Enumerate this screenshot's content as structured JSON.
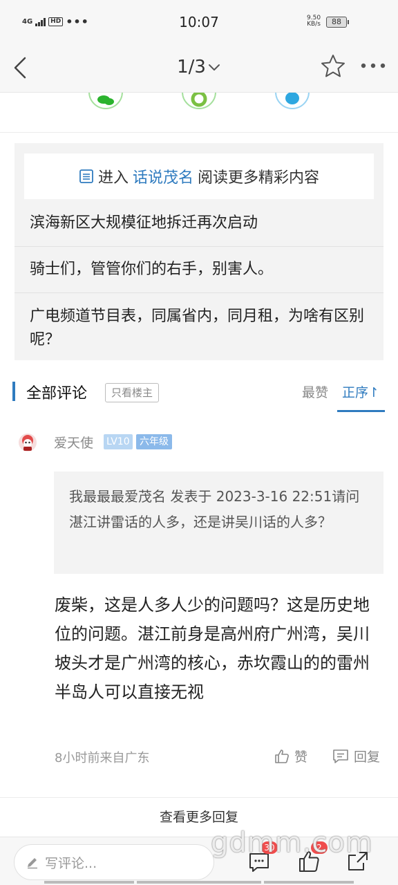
{
  "status_bar": {
    "network": "4G",
    "hd": "HD",
    "dots": "•••",
    "time": "10:07",
    "speed_value": "9.50",
    "speed_unit": "KB/s",
    "battery": "88"
  },
  "nav": {
    "title": "1/3",
    "back_icon": "chevron-left-icon",
    "favorite_icon": "star-outline-icon",
    "more_icon": "more-horizontal-icon"
  },
  "share": {
    "icons": [
      "wechat-icon",
      "moments-icon",
      "qq-icon"
    ],
    "colors": {
      "wechat": "#2bb32e",
      "moments": "#7bc043",
      "qq": "#2ea7e0"
    }
  },
  "related": {
    "enter_prefix": "进入",
    "forum_name": "话说茂名",
    "enter_suffix": "阅读更多精彩内容",
    "items": [
      "滨海新区大规模征地拆迁再次启动",
      "骑士们，管管你们的右手，别害人。",
      "广电频道节目表，同属省内，同月租，为啥有区别呢？"
    ]
  },
  "comments_header": {
    "title": "全部评论",
    "owner_only": "只看楼主",
    "sort_hot": "最赞",
    "sort_asc": "正序↾",
    "accent_color": "#2f7bbf"
  },
  "comment": {
    "username": "爱天使",
    "level": "LV10",
    "grade": "六年级",
    "quote": "我最最最爱茂名 发表于 2023-3-16 22:51请问湛江讲雷话的人多，还是讲吴川话的人多？",
    "body": "废柴，这是人多人少的问题吗？这是历史地位的问题。湛江前身是高州府广州湾，吴川坡头才是广州湾的核心，赤坎霞山的的雷州半岛人可以直接无视",
    "meta": "8小时前来自广东",
    "like_label": "赞",
    "reply_label": "回复"
  },
  "more_replies": "查看更多回复",
  "bottom_bar": {
    "placeholder": "写评论...",
    "comment_count": "30",
    "like_count": "2"
  },
  "watermark": "gdmm.com"
}
